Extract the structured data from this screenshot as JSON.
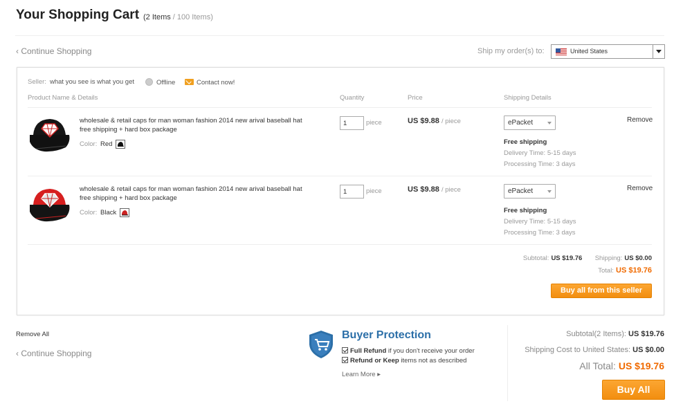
{
  "header": {
    "title": "Your Shopping Cart",
    "count_prefix": "(2 Items",
    "count_suffix": " / 100 Items)",
    "continue_shopping": "‹ Continue Shopping",
    "ship_to_label": "Ship my order(s) to:",
    "country": "United States",
    "country_flag_icon": "us-flag-icon"
  },
  "seller": {
    "label": "Seller:",
    "name": "what you see is what you get",
    "status": "Offline",
    "contact": "Contact now!"
  },
  "columns": {
    "product": "Product Name & Details",
    "quantity": "Quantity",
    "price": "Price",
    "shipping": "Shipping Details"
  },
  "items": [
    {
      "name_line1": "wholesale & retail caps for man woman fashion 2014 new arival baseball hat",
      "name_line2": "free shipping + hard box package",
      "color_label": "Color:",
      "color": "Red",
      "quantity": "1",
      "unit": "piece",
      "price": "US $9.88",
      "per": "/ piece",
      "shipping_method": "ePacket",
      "free_shipping": "Free shipping",
      "delivery_label": "Delivery Time:",
      "delivery": "5-15 days",
      "processing_label": "Processing Time:",
      "processing": "3 days",
      "remove": "Remove",
      "thumb_colors": {
        "crown": "#161616",
        "brim": "#111111"
      }
    },
    {
      "name_line1": "wholesale & retail caps for man woman fashion 2014 new arival baseball hat",
      "name_line2": "free shipping + hard box package",
      "color_label": "Color:",
      "color": "Black",
      "quantity": "1",
      "unit": "piece",
      "price": "US $9.88",
      "per": "/ piece",
      "shipping_method": "ePacket",
      "free_shipping": "Free shipping",
      "delivery_label": "Delivery Time:",
      "delivery": "5-15 days",
      "processing_label": "Processing Time:",
      "processing": "3 days",
      "remove": "Remove",
      "thumb_colors": {
        "crown": "#d61f1f",
        "brim": "#141414"
      }
    }
  ],
  "seller_totals": {
    "subtotal_label": "Subtotal:",
    "subtotal": "US $19.76",
    "shipping_label": "Shipping:",
    "shipping": "US $0.00",
    "total_label": "Total:",
    "total": "US $19.76",
    "buy_button": "Buy all from this seller"
  },
  "footer": {
    "remove_all": "Remove All",
    "continue_shopping": "‹ Continue Shopping",
    "protection_title": "Buyer Protection",
    "full_refund_bold": "Full Refund",
    "full_refund_rest": " if you don't receive your order",
    "refund_keep_bold": "Refund or Keep",
    "refund_keep_rest": " items not as described",
    "learn_more": "Learn More ▸",
    "subtotal_label": "Subtotal(2 Items):",
    "subtotal": "US $19.76",
    "shipping_label": "Shipping Cost to United States:",
    "shipping": "US $0.00",
    "all_total_label": "All Total:",
    "all_total": "US $19.76",
    "buy_all": "Buy All"
  },
  "colors": {
    "accent_orange": "#f28e0f",
    "price_orange": "#f06a00",
    "protection_blue": "#2c6fa8"
  }
}
